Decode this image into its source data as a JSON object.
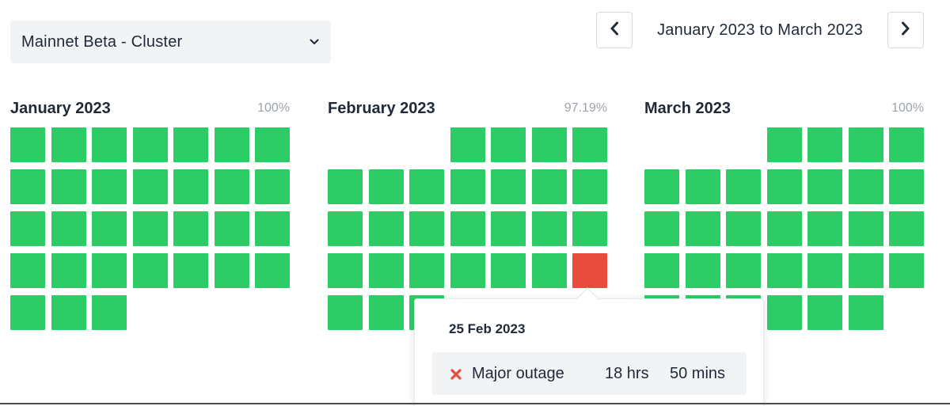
{
  "cluster_select": {
    "value": "Mainnet Beta - Cluster"
  },
  "date_nav": {
    "range_label": "January 2023 to March 2023"
  },
  "colors": {
    "operational": "#2ecc66",
    "major_outage": "#e74c3c"
  },
  "months": [
    {
      "title": "January 2023",
      "uptime": "100%",
      "leading_blanks": 0,
      "days": [
        "ok",
        "ok",
        "ok",
        "ok",
        "ok",
        "ok",
        "ok",
        "ok",
        "ok",
        "ok",
        "ok",
        "ok",
        "ok",
        "ok",
        "ok",
        "ok",
        "ok",
        "ok",
        "ok",
        "ok",
        "ok",
        "ok",
        "ok",
        "ok",
        "ok",
        "ok",
        "ok",
        "ok",
        "ok",
        "ok",
        "ok"
      ]
    },
    {
      "title": "February 2023",
      "uptime": "97.19%",
      "leading_blanks": 3,
      "days": [
        "ok",
        "ok",
        "ok",
        "ok",
        "ok",
        "ok",
        "ok",
        "ok",
        "ok",
        "ok",
        "ok",
        "ok",
        "ok",
        "ok",
        "ok",
        "ok",
        "ok",
        "ok",
        "ok",
        "ok",
        "ok",
        "ok",
        "ok",
        "ok",
        "major",
        "ok",
        "ok",
        "ok"
      ]
    },
    {
      "title": "March 2023",
      "uptime": "100%",
      "leading_blanks": 3,
      "days": [
        "ok",
        "ok",
        "ok",
        "ok",
        "ok",
        "ok",
        "ok",
        "ok",
        "ok",
        "ok",
        "ok",
        "ok",
        "ok",
        "ok",
        "ok",
        "ok",
        "ok",
        "ok",
        "ok",
        "ok",
        "ok",
        "ok",
        "ok",
        "ok",
        "ok",
        "ok",
        "ok",
        "ok",
        "ok",
        "ok",
        "ok"
      ]
    }
  ],
  "tooltip": {
    "date": "25 Feb 2023",
    "status_icon": "x-icon",
    "status": "Major outage",
    "hours": "18 hrs",
    "minutes": "50 mins"
  }
}
